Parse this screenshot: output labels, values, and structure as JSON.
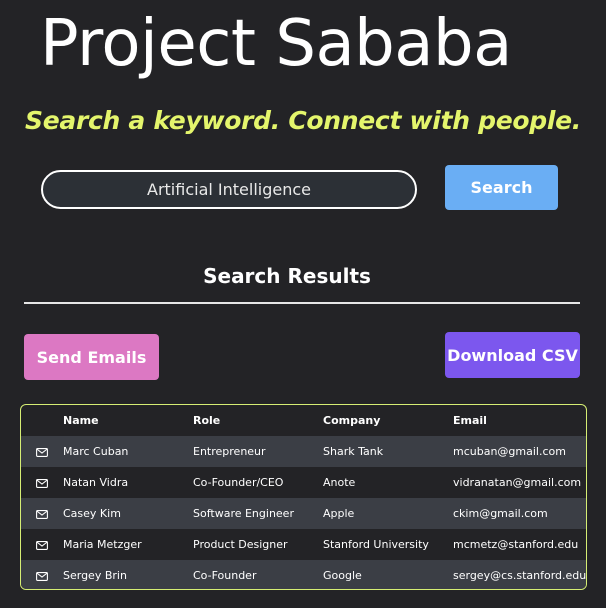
{
  "header": {
    "title": "Project Sababa",
    "tagline": "Search a keyword. Connect with people."
  },
  "search": {
    "value": "Artificial Intelligence",
    "button_label": "Search"
  },
  "results": {
    "heading": "Search Results",
    "send_button_label": "Send Emails",
    "download_button_label": "Download CSV",
    "columns": [
      "Name",
      "Role",
      "Company",
      "Email"
    ],
    "rows": [
      {
        "icon": "mail-icon",
        "name": "Marc Cuban",
        "role": "Entrepreneur",
        "company": "Shark Tank",
        "email": "mcuban@gmail.com"
      },
      {
        "icon": "mail-icon",
        "name": "Natan Vidra",
        "role": "Co-Founder/CEO",
        "company": "Anote",
        "email": "vidranatan@gmail.com"
      },
      {
        "icon": "mail-icon",
        "name": "Casey Kim",
        "role": "Software Engineer",
        "company": "Apple",
        "email": "ckim@gmail.com"
      },
      {
        "icon": "mail-icon",
        "name": "Maria Metzger",
        "role": "Product Designer",
        "company": "Stanford University",
        "email": "mcmetz@stanford.edu"
      },
      {
        "icon": "mail-icon",
        "name": "Sergey Brin",
        "role": "Co-Founder",
        "company": "Google",
        "email": "sergey@cs.stanford.edu"
      }
    ]
  },
  "colors": {
    "background": "#232326",
    "tagline": "#e4f56c",
    "search_button": "#6aaef4",
    "send_button": "#dc78c3",
    "download_button": "#7c57ee",
    "table_border": "#d6ee74",
    "row_stripe": "#3b3e45"
  }
}
